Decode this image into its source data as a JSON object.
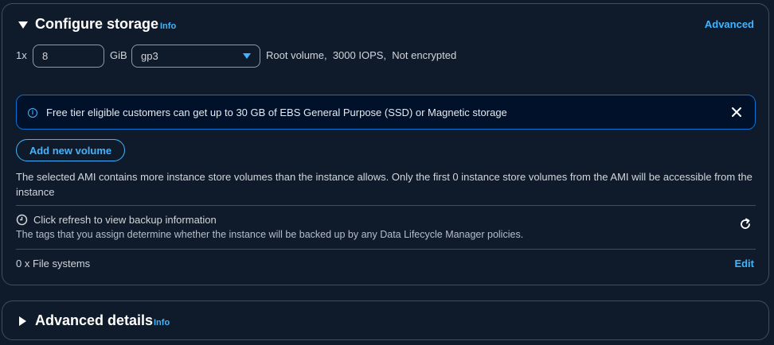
{
  "storage": {
    "title": "Configure storage",
    "info": "Info",
    "advanced_link": "Advanced",
    "volume": {
      "count_prefix": "1x",
      "size_value": "8",
      "unit": "GiB",
      "type_selected": "gp3",
      "description_root": "Root volume,",
      "description_iops": "3000 IOPS,",
      "description_encrypted": "Not encrypted"
    },
    "alert": {
      "message": "Free tier eligible customers can get up to 30 GB of EBS General Purpose (SSD) or Magnetic storage"
    },
    "add_volume_label": "Add new volume",
    "ami_notice": "The selected AMI contains more instance store volumes than the instance allows. Only the first 0 instance store volumes from the AMI will be accessible from the instance",
    "backup": {
      "title": "Click refresh to view backup information",
      "description": "The tags that you assign determine whether the instance will be backed up by any Data Lifecycle Manager policies."
    },
    "file_systems": {
      "label": "0 x File systems",
      "edit_label": "Edit"
    }
  },
  "advanced_details": {
    "title": "Advanced details",
    "info": "Info"
  },
  "colors": {
    "background": "#0f1b2a",
    "accent": "#42b4ff",
    "border": "#414d5c",
    "alert_border": "#0972d3"
  },
  "icons": [
    "caret-down-icon",
    "select-arrow-icon",
    "info-circle-icon",
    "close-icon",
    "clock-icon",
    "refresh-icon",
    "caret-right-icon"
  ]
}
